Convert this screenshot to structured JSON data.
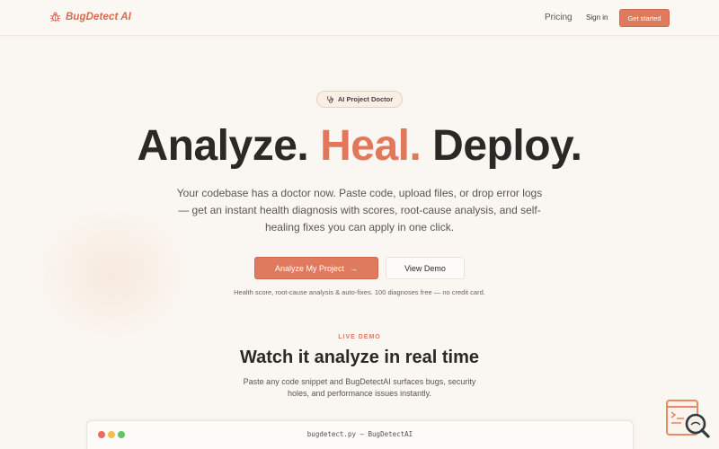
{
  "nav": {
    "brand_name": "BugDetect AI",
    "pricing_label": "Pricing",
    "signin_label": "Sign in",
    "cta_label": "Get started"
  },
  "badge": {
    "label": "AI Project Doctor",
    "icon": "stethoscope-icon"
  },
  "hero": {
    "title_part1": "Analyze.",
    "title_accent": "Heal.",
    "title_part3": "Deploy.",
    "subtitle": "Your codebase has a doctor now. Paste code, upload files, or drop error logs — get an instant health diagnosis with scores, root-cause analysis, and self-healing fixes you can apply in one click.",
    "primary_button": "Analyze My Project",
    "secondary_button": "View Demo",
    "note": "Health score, root-cause analysis & auto-fixes. 100 diagnoses free — no credit card."
  },
  "demo": {
    "kicker": "LIVE DEMO",
    "title": "Watch it analyze in real time",
    "subtitle": "Paste any code snippet and BugDetectAI surfaces bugs, security holes, and performance issues instantly.",
    "window_title": "bugdetect.py — BugDetectAI"
  },
  "colors": {
    "accent": "#e07a5f",
    "background": "#faf6f1",
    "text": "#2b2826"
  }
}
